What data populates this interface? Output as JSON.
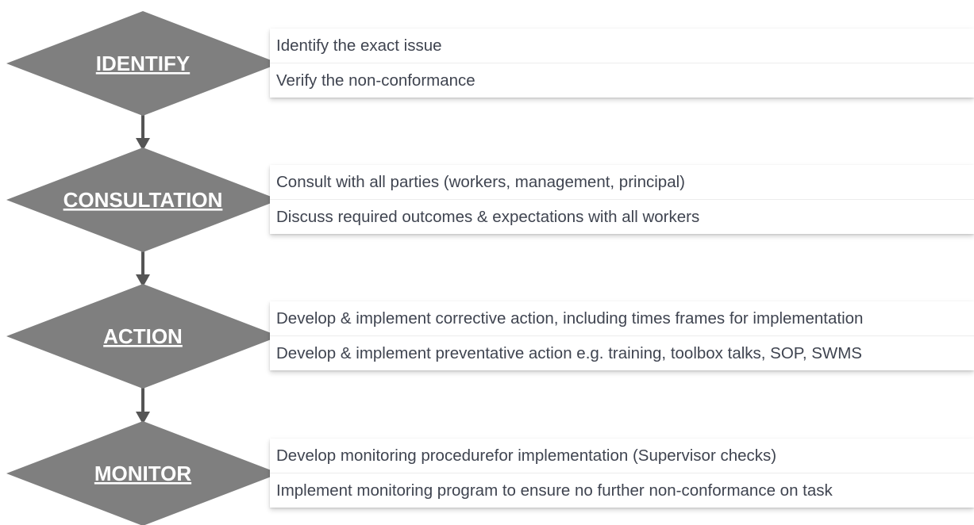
{
  "colors": {
    "diamond": "#7f7f7f",
    "connector": "#555555",
    "label": "#ffffff",
    "text": "#3f4450"
  },
  "steps": [
    {
      "label": "IDENTIFY",
      "items": [
        "Identify the exact issue",
        "Verify the non-conformance"
      ]
    },
    {
      "label": "CONSULTATION ",
      "items": [
        "Consult with all parties (workers, management, principal)",
        "Discuss required outcomes & expectations with all workers"
      ]
    },
    {
      "label": "ACTION",
      "items": [
        "Develop & implement corrective action, including times frames for implementation",
        "Develop & implement preventative action e.g. training, toolbox talks, SOP, SWMS"
      ]
    },
    {
      "label": "MONITOR",
      "items": [
        "Develop monitoring procedurefor implementation (Supervisor checks)",
        "Implement monitoring program to ensure no further non-conformance on task"
      ]
    }
  ]
}
